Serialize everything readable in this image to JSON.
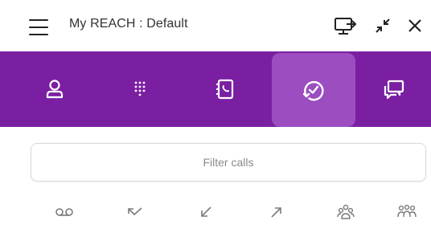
{
  "app": {
    "title": "My REACH : Default"
  },
  "titlebar": {
    "menu_icon": "hamburger-icon",
    "buttons": [
      {
        "name": "screen-share-button",
        "icon": "monitor-arrow-icon"
      },
      {
        "name": "minimize-button",
        "icon": "collapse-arrows-icon"
      },
      {
        "name": "close-button",
        "icon": "close-icon"
      }
    ]
  },
  "nav": {
    "background": "#7b1fa2",
    "active_background": "#9c4dc0",
    "active_tab": "call-history",
    "items": [
      {
        "id": "contacts",
        "icon": "person-icon"
      },
      {
        "id": "dialpad",
        "icon": "dialpad-icon"
      },
      {
        "id": "phonebook",
        "icon": "phonebook-icon"
      },
      {
        "id": "call-history",
        "icon": "call-history-icon"
      },
      {
        "id": "messages",
        "icon": "chat-icon"
      }
    ]
  },
  "filter": {
    "placeholder": "Filter calls",
    "value": ""
  },
  "call_filters": [
    {
      "id": "voicemail",
      "icon": "voicemail-icon"
    },
    {
      "id": "missed",
      "icon": "missed-call-icon"
    },
    {
      "id": "incoming",
      "icon": "incoming-call-icon"
    },
    {
      "id": "outgoing",
      "icon": "outgoing-call-icon"
    },
    {
      "id": "group",
      "icon": "group-icon"
    },
    {
      "id": "conference",
      "icon": "conference-icon"
    }
  ]
}
